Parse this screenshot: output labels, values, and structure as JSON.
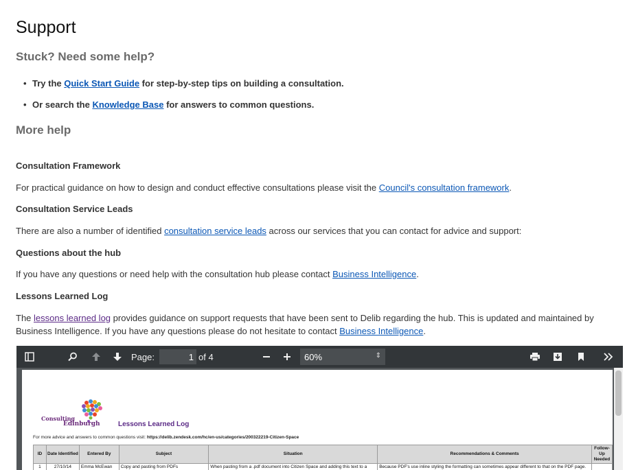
{
  "page": {
    "title": "Support",
    "subtitle": "Stuck? Need some help?",
    "more_help": "More help"
  },
  "bullets": [
    {
      "prefix": "Try the ",
      "link": "Quick Start Guide",
      "suffix": " for step-by-step tips on building a consultation."
    },
    {
      "prefix": "Or search the ",
      "link": "Knowledge Base",
      "suffix": " for answers to common questions."
    }
  ],
  "sections": {
    "framework": {
      "heading": "Consultation Framework",
      "text_before": "For practical guidance on how to design and conduct effective consultations please visit the ",
      "link": "Council's consultation framework",
      "text_after": "."
    },
    "leads": {
      "heading": "Consultation Service Leads",
      "text_before": "There are also a number of identified ",
      "link": "consultation service leads",
      "text_after": " across our services that you can contact for advice and support:"
    },
    "hub": {
      "heading": "Questions about the hub",
      "text_before": "If you have any questions or need help with the consultation hub please contact ",
      "link": "Business Intelligence",
      "text_after": "."
    },
    "lessons": {
      "heading": "Lessons Learned Log",
      "text_1": "The ",
      "link_1": "lessons learned log",
      "text_2": " provides guidance on support requests that have been sent to Delib regarding the hub. This is updated and maintained by Business Intelligence. If you have any questions please do not hesitate to contact ",
      "link_2": "Business Intelligence",
      "text_3": "."
    }
  },
  "pdf_viewer": {
    "page_label": "Page:",
    "current_page": "1",
    "page_count": "of 4",
    "zoom": "60%",
    "icons": [
      "sidebar-toggle-icon",
      "search-icon",
      "previous-page-icon",
      "next-page-icon",
      "zoom-out-icon",
      "zoom-in-icon",
      "print-icon",
      "download-icon",
      "bookmark-icon",
      "more-tools-icon"
    ],
    "document": {
      "logo_line_1": "Consulting",
      "logo_line_2": "Edinburgh",
      "title": "Lessons Learned Log",
      "advice_prefix": "For more advice and answers to common questions visit: ",
      "advice_url": "https://delib.zendesk.com/hc/en-us/categories/200322219-Citizen-Space",
      "table": {
        "headers": [
          "ID",
          "Date Identified",
          "Entered By",
          "Subject",
          "Situation",
          "Recommendations & Comments",
          "Follow-Up Needed"
        ],
        "rows": [
          [
            "1",
            "27/10/14",
            "Emma McEwan",
            "Copy and pasting from PDFs",
            "When pasting from a .pdf document into Citizen Space and adding this text to a new page the text can appear formatted as 'Times New Roman', which",
            "Because PDF's use inline styling the formatting can sometimes appear different to that on the PDF page.",
            ""
          ]
        ]
      }
    }
  }
}
